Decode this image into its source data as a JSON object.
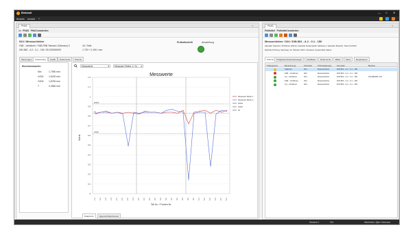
{
  "window": {
    "title": "Elektrodi",
    "menu": [
      "Bedarfs",
      "Ansicht",
      "?"
    ],
    "controls": [
      "—",
      "□",
      "✕"
    ]
  },
  "left": {
    "tab": "PHAS",
    "crumb_parts": [
      "Im",
      "PHAS",
      "PHAS bearbeiten"
    ],
    "header": "024 / Messschieber",
    "line1_left": "FAB - Verfahren / FAB-FBB Toleranz (Toleranz) 0",
    "line1_right": "16 / Teile",
    "line2_left": "DIN 862 - A 2 - 0,1 - 150 / 50.000000000",
    "line2_right": "1.700 + 0.150 / mm",
    "status_label": "Prüfzeitschritt",
    "status_value": "Auswertung",
    "subtabs": [
      "Messungen",
      "Auswertung",
      "Grafik",
      "Dokumente",
      "Historie"
    ],
    "kennwerte": {
      "title": "Einzelmesswerte",
      "rows": [
        {
          "label": "Min",
          "value": "1,7950 mm"
        },
        {
          "label": "UGW",
          "value": "1,6230 mm"
        },
        {
          "label": "OGW",
          "value": "1,8750 mm"
        },
        {
          "label": "T",
          "value": "0,4560 mm"
        }
      ]
    },
    "chart_toolbar": {
      "select1": "Messwerte",
      "select2": "Messwert Reihe 1 / N..."
    },
    "bottom_tabs": [
      "Diagramm",
      "Eigenschaftenfenster"
    ]
  },
  "right": {
    "tab": "PHAS",
    "crumb_parts": [
      "Prüfmittel",
      "Prüfmittel bearbeiten"
    ],
    "header": "Messschieber / 024 / DIN 862 - A 2 - 0.1 - 150",
    "line1": "Aktueller Standort: Prüfbörse (Werk) / Aktuelle Kostenstelle: Meßraum / Aktueller Besitzer: Peter Fröhlich",
    "line2": "Nächste Prüfung: Samstag, 16. Oktober 2021 / Zustand: verwendbar   Status:",
    "subtabs": [
      "Historie",
      "Prüfgebrauchsanweisungen",
      "Zertifikate",
      "Dokumente",
      "Bilder",
      "Mess",
      "Reparaturen"
    ],
    "table": {
      "columns": [
        "Prüfergebnis",
        "Bezeichnung",
        "Prüfmittel",
        "Prüfmittelgruppe",
        "Kennzahl",
        "Besitzer"
      ],
      "rows": [
        {
          "status": "yellow",
          "bez": "Kalibriert",
          "pm": "024",
          "grp": "Messschieber",
          "kz": "DIN 862 - A 2 - 0.1 - 150",
          "bes": ""
        },
        {
          "status": "red",
          "bez": "FAB - Verfahren",
          "pm": "024",
          "grp": "Messschieber",
          "kz": "DIN 862 - A 2 - 0.1 - 150",
          "bes": ""
        },
        {
          "status": "green",
          "bez": "Cp - Verfahren",
          "pm": "024",
          "grp": "Messschieber",
          "kz": "DIN 862 - A 2 - 0.1 - 150",
          "bes": "FR-ABMPK-701"
        },
        {
          "status": "green",
          "bez": "FAB - Verfahren",
          "pm": "024",
          "grp": "Messschieber",
          "kz": "DIN 862 - A 2 - 0.1 - 150",
          "bes": ""
        },
        {
          "status": "green",
          "bez": "Cg - Verfahren",
          "pm": "024",
          "grp": "Messschieber",
          "kz": "DIN 862 - A 2 - 0.1 - 150",
          "bes": ""
        }
      ]
    }
  },
  "status_bar": {
    "left_a": "Standort 1",
    "left_b": "024",
    "right": "Mitarbeiter, Björn Sielmann"
  },
  "colors": {
    "ok": "#3aa335",
    "warn": "#e6c229",
    "error": "#d8342a",
    "series1": "#c44",
    "series2": "#5a6fd8"
  },
  "chart_data": {
    "type": "line",
    "title": "Messwerte",
    "xlabel": "Teil Nr. / Proben Nr.",
    "ylabel": "Werte",
    "ylim": [
      0.0,
      2.1
    ],
    "yticks": [
      0.0,
      0.1,
      0.2,
      0.3,
      0.4,
      0.5,
      0.6,
      0.7,
      0.8,
      0.9,
      1.0,
      1.1,
      1.2
    ],
    "ytick_labels": [
      "0",
      "0.1",
      "0.2",
      "0.3",
      "0.4",
      "0.5",
      "0.6",
      "0.7",
      "0.8",
      "0.9",
      "1",
      "1.1",
      "1.2"
    ],
    "limit_lines": [
      {
        "label": "OGW",
        "value": 0.925
      },
      {
        "label": "Ist",
        "value": 0.83
      },
      {
        "label": "UGW",
        "value": 0.62
      }
    ],
    "x": [
      1,
      2,
      3,
      4,
      5,
      6,
      7,
      8,
      9,
      10,
      11,
      12,
      13,
      14,
      15,
      16,
      17,
      18,
      19,
      20,
      21,
      22,
      23,
      24,
      25
    ],
    "xtick_labels": [
      "1.1",
      "1.2",
      "1.3",
      "1.4",
      "2.1",
      "2.2",
      "2.3",
      "2.4",
      "2.5",
      "3.1",
      "3.2",
      "3.3",
      "3.4",
      "3.5",
      "4.1",
      "4.2",
      "4.3",
      "4.4",
      "4.5",
      "5.1",
      "5.2",
      "5.3",
      "5.4",
      "5.5",
      "6.1"
    ],
    "series": [
      {
        "name": "Messwert Reihe 1",
        "values": [
          0.82,
          0.84,
          0.85,
          0.83,
          0.84,
          0.83,
          0.84,
          0.83,
          0.82,
          0.85,
          0.84,
          0.84,
          0.83,
          0.84,
          0.84,
          0.83,
          0.86,
          0.72,
          0.84,
          0.85,
          0.86,
          0.83,
          0.86,
          0.84,
          0.86
        ]
      },
      {
        "name": "Messwert Reihe 2",
        "values": [
          0.83,
          0.84,
          0.84,
          0.83,
          0.84,
          0.82,
          0.49,
          0.84,
          0.83,
          0.84,
          0.84,
          0.84,
          0.83,
          0.86,
          0.87,
          0.85,
          0.84,
          0.14,
          0.83,
          0.84,
          0.84,
          0.28,
          0.82,
          0.86,
          0.85
        ]
      }
    ],
    "legend": [
      "Messwert Reihe 1",
      "Messwert Reihe 2",
      "OGW",
      "UGW",
      "Ist"
    ],
    "legend_position": "right"
  }
}
